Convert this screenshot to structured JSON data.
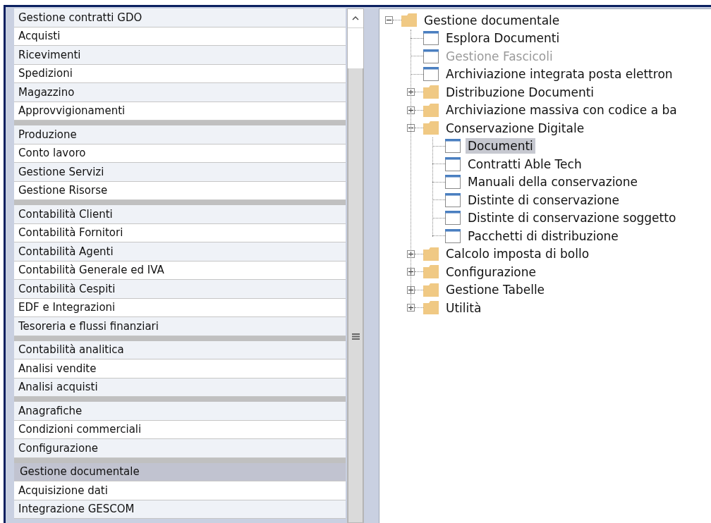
{
  "menu": {
    "groups": [
      {
        "items": [
          {
            "label": "Gestione contratti GDO",
            "selected": false
          },
          {
            "label": "Acquisti",
            "selected": false
          },
          {
            "label": "Ricevimenti",
            "selected": false
          },
          {
            "label": "Spedizioni",
            "selected": false
          },
          {
            "label": "Magazzino",
            "selected": false
          },
          {
            "label": "Approvvigionamenti",
            "selected": false
          }
        ]
      },
      {
        "items": [
          {
            "label": "Produzione",
            "selected": false
          },
          {
            "label": "Conto lavoro",
            "selected": false
          },
          {
            "label": "Gestione Servizi",
            "selected": false
          },
          {
            "label": "Gestione Risorse",
            "selected": false
          }
        ]
      },
      {
        "items": [
          {
            "label": "Contabilità Clienti",
            "selected": false
          },
          {
            "label": "Contabilità Fornitori",
            "selected": false
          },
          {
            "label": "Contabilità Agenti",
            "selected": false
          },
          {
            "label": "Contabilità Generale ed IVA",
            "selected": false
          },
          {
            "label": "Contabilità Cespiti",
            "selected": false
          },
          {
            "label": "EDF e Integrazioni",
            "selected": false
          },
          {
            "label": "Tesoreria e flussi finanziari",
            "selected": false
          }
        ]
      },
      {
        "items": [
          {
            "label": "Contabilità analitica",
            "selected": false
          },
          {
            "label": "Analisi vendite",
            "selected": false
          },
          {
            "label": "Analisi acquisti",
            "selected": false
          }
        ]
      },
      {
        "items": [
          {
            "label": "Anagrafiche",
            "selected": false
          },
          {
            "label": "Condizioni commerciali",
            "selected": false
          },
          {
            "label": "Configurazione",
            "selected": false
          }
        ]
      },
      {
        "items": [
          {
            "label": "Gestione documentale",
            "selected": true
          },
          {
            "label": "Acquisizione dati",
            "selected": false
          },
          {
            "label": "Integrazione GESCOM",
            "selected": false
          }
        ]
      }
    ]
  },
  "tree": [
    {
      "kind": "folder",
      "label": "Gestione documentale",
      "expanded": true,
      "children": [
        {
          "kind": "form",
          "label": "Esplora Documenti",
          "disabled": false,
          "selected": false
        },
        {
          "kind": "form",
          "label": "Gestione Fascicoli",
          "disabled": true,
          "selected": false
        },
        {
          "kind": "form",
          "label": "Archiviazione integrata posta elettron",
          "disabled": false,
          "selected": false
        },
        {
          "kind": "folder",
          "label": "Distribuzione Documenti",
          "expanded": false
        },
        {
          "kind": "folder",
          "label": "Archiviazione massiva con codice a ba",
          "expanded": false
        },
        {
          "kind": "folder",
          "label": "Conservazione Digitale",
          "expanded": true,
          "children": [
            {
              "kind": "form",
              "label": "Documenti",
              "disabled": false,
              "selected": true
            },
            {
              "kind": "form",
              "label": "Contratti Able Tech",
              "disabled": false,
              "selected": false
            },
            {
              "kind": "form",
              "label": "Manuali della conservazione",
              "disabled": false,
              "selected": false
            },
            {
              "kind": "form",
              "label": "Distinte di conservazione",
              "disabled": false,
              "selected": false
            },
            {
              "kind": "form",
              "label": "Distinte di conservazione soggetto",
              "disabled": false,
              "selected": false
            },
            {
              "kind": "form",
              "label": "Pacchetti di distribuzione",
              "disabled": false,
              "selected": false
            }
          ]
        },
        {
          "kind": "folder",
          "label": "Calcolo imposta di bollo",
          "expanded": false
        },
        {
          "kind": "folder",
          "label": "Configurazione",
          "expanded": false
        },
        {
          "kind": "folder",
          "label": "Gestione Tabelle",
          "expanded": false
        },
        {
          "kind": "folder",
          "label": "Utilità",
          "expanded": false
        }
      ]
    }
  ]
}
